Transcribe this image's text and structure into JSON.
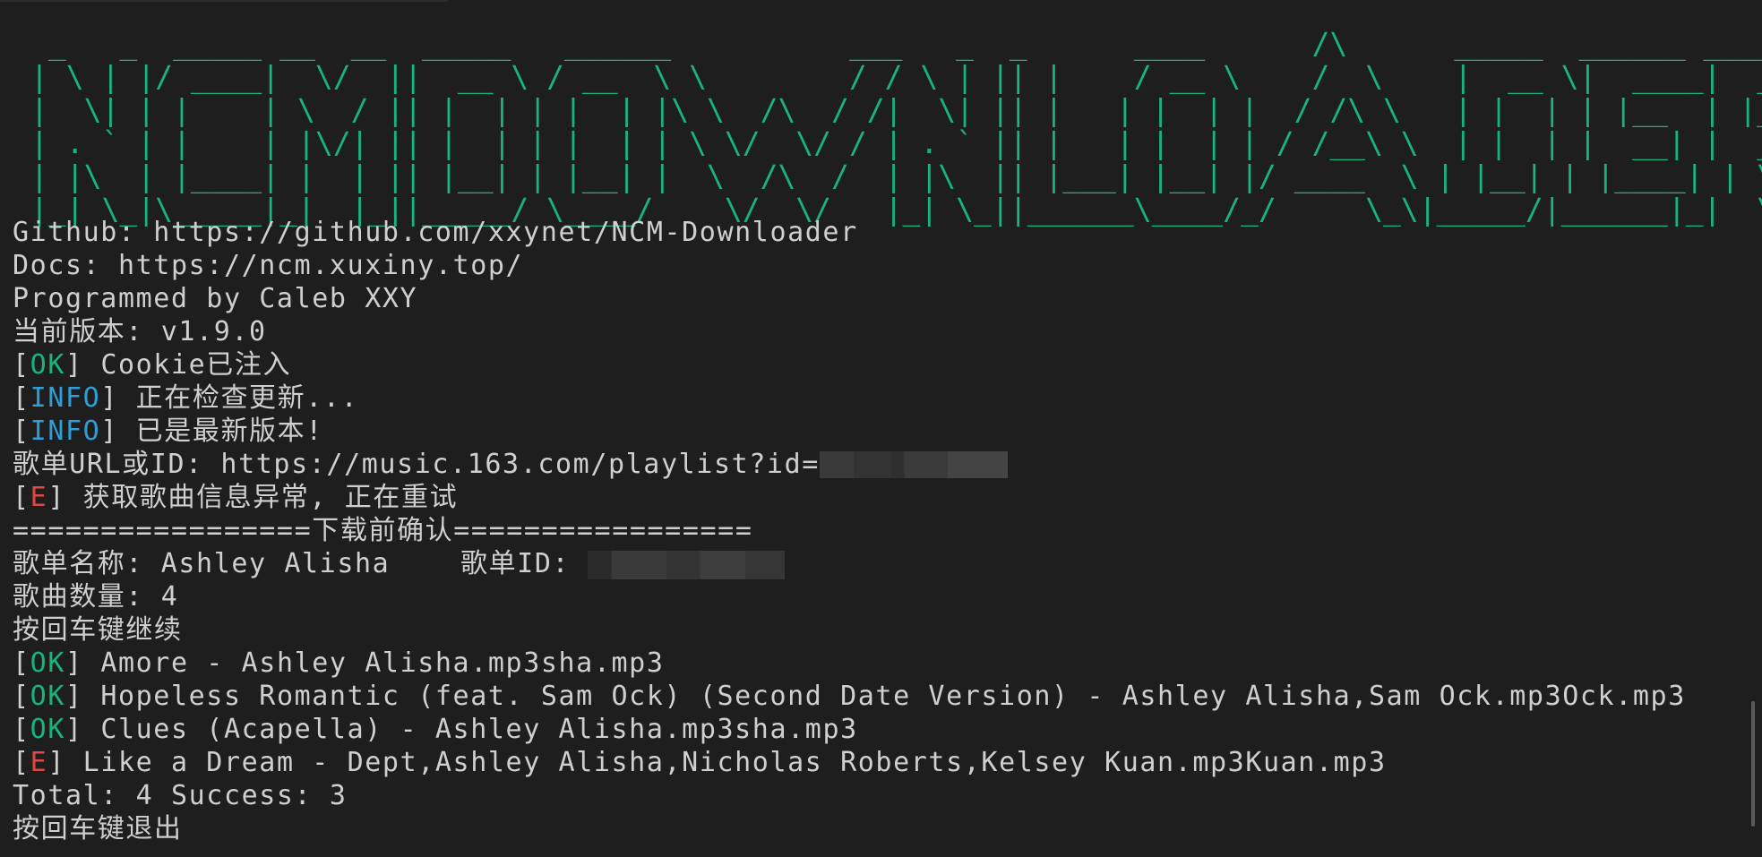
{
  "banner": {
    "text": " _   _  _____ __  __  _____   ______          ___   _  _      ____      /\\      _____  ______ _____  \n| \\ | |/ ____|  \\/  ||  __ \\ / __  \\ \\        / / \\ | || |    / __ \\    /  \\    |  __ \\|  ____|  __ \\ \n|  \\| | |    | \\  / || |  | | |  | |\\ \\  /\\  / /|  \\| || |   | |  | |  / /\\ \\   | |  | | |__  | |__) |\n| . ` | |    | |\\/| || |  | | |  | | \\ \\/  \\/ / | . ` || |   | |  | | / /__\\ \\  | |  | |  __| |  _  / \n| |\\  | |____| |  | || |__| | |__| |  \\  /\\  /  | |\\  || |___| |__| |/ ____  \\ | |__| | |____| | \\ \\ \n|_| \\_|\\_____|_|  |_||_____/ \\____/    \\/  \\/   |_| \\_||______\\____/_/     \\_\\|_____/|______|_|  \\_\\",
    "word": "NCMDOWNLOADER"
  },
  "console": {
    "github": "Github: https://github.com/xxynet/NCM-Downloader",
    "docs": "Docs: https://ncm.xuxiny.top/",
    "author": "Programmed by Caleb XXY",
    "version": "当前版本: v1.9.0",
    "lines": [
      {
        "tag": "OK",
        "text": "] Cookie已注入"
      },
      {
        "tag": "INFO",
        "text": "] 正在检查更新..."
      },
      {
        "tag": "INFO",
        "text": "] 已是最新版本!"
      }
    ],
    "playlist_prompt": "歌单URL或ID: https://music.163.com/playlist?id=",
    "retry_error": {
      "tag": "E",
      "text": "] 获取歌曲信息异常, 正在重试"
    },
    "confirm_header": "=================下载前确认=================",
    "playlist_name": "歌单名称: Ashley Alisha    歌单ID: ",
    "song_count": "歌曲数量: 4",
    "press_continue": "按回车键继续",
    "results": [
      {
        "tag": "OK",
        "status": "ok",
        "text": "] Amore - Ashley Alisha.mp3sha.mp3"
      },
      {
        "tag": "OK",
        "status": "ok",
        "text": "] Hopeless Romantic (feat. Sam Ock) (Second Date Version) - Ashley Alisha,Sam Ock.mp3Ock.mp3"
      },
      {
        "tag": "OK",
        "status": "ok",
        "text": "] Clues (Acapella) - Ashley Alisha.mp3sha.mp3"
      },
      {
        "tag": "E",
        "status": "error",
        "text": "] Like a Dream - Dept,Ashley Alisha,Nicholas Roberts,Kelsey Kuan.mp3Kuan.mp3"
      }
    ],
    "total": "Total: 4 Success: 3",
    "press_exit": "按回车键退出",
    "open_bracket": "["
  },
  "colors": {
    "background": "#1e1e1e",
    "text": "#cfcfcf",
    "ok": "#17b57c",
    "info": "#2e9fd6",
    "error": "#e04848"
  }
}
